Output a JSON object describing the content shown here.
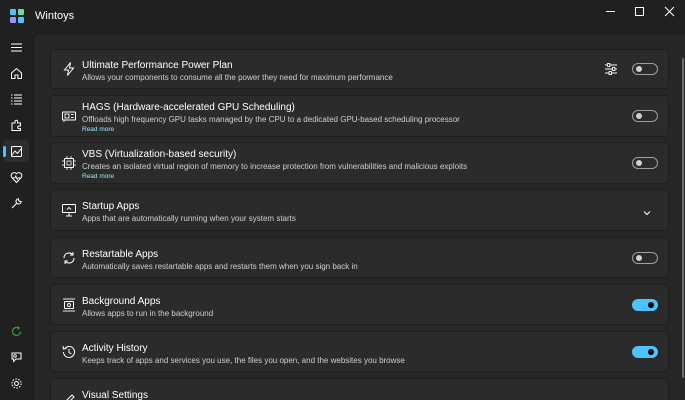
{
  "window": {
    "title": "Wintoys"
  },
  "sidebar": {
    "items": [
      {
        "icon": "hamburger-menu-icon"
      },
      {
        "icon": "home-icon"
      },
      {
        "icon": "apps-list-icon"
      },
      {
        "icon": "extensions-icon"
      },
      {
        "icon": "performance-icon",
        "selected": true
      },
      {
        "icon": "health-icon"
      },
      {
        "icon": "tools-icon"
      }
    ],
    "bottom_items": [
      {
        "icon": "update-icon"
      },
      {
        "icon": "feedback-icon"
      },
      {
        "icon": "settings-icon"
      }
    ]
  },
  "accent_color": "#4cc2ff",
  "cards": [
    {
      "title": "Ultimate Performance Power Plan",
      "description": "Allows your components to consume all the power they need for maximum performance",
      "icon": "lightning-icon",
      "toggle": false,
      "has_settings": true
    },
    {
      "title": "HAGS (Hardware-accelerated GPU Scheduling)",
      "description": "Offloads high frequency GPU tasks managed by the CPU to a dedicated GPU-based scheduling processor",
      "link": "Read more",
      "icon": "gpu-icon",
      "toggle": false
    },
    {
      "title": "VBS (Virtualization-based security)",
      "description": "Creates an isolated virtual region of memory to increase protection from vulnerabilities and malicious exploits",
      "link": "Read more",
      "icon": "chip-icon",
      "toggle": false
    },
    {
      "title": "Startup Apps",
      "description": "Apps that are automatically running when your system starts",
      "icon": "startup-icon",
      "expandable": true
    },
    {
      "title": "Restartable Apps",
      "description": "Automatically saves restartable apps and restarts them when you sign back in",
      "icon": "restart-icon",
      "toggle": false
    },
    {
      "title": "Background Apps",
      "description": "Allows apps to run in the background",
      "icon": "background-apps-icon",
      "toggle": true
    },
    {
      "title": "Activity History",
      "description": "Keeps track of apps and services you use, the files you open, and the websites you browse",
      "icon": "history-icon",
      "toggle": true
    },
    {
      "title": "Visual Settings",
      "description": "",
      "icon": "visual-icon",
      "expandable": true
    }
  ]
}
